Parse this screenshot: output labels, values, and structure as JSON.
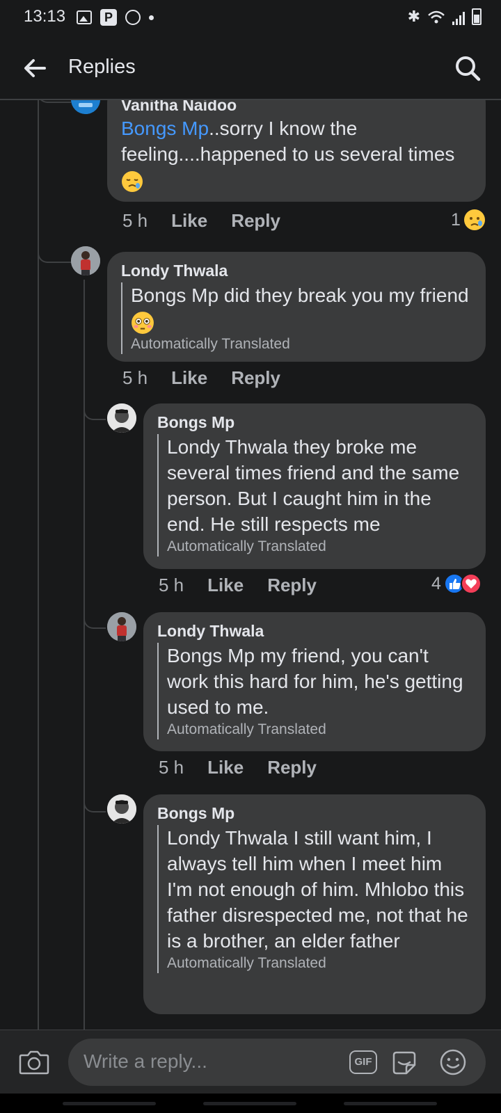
{
  "status_bar": {
    "time": "13:13",
    "notification_letter": "P"
  },
  "header": {
    "title": "Replies"
  },
  "comments": [
    {
      "author": "Vanitha Naidoo",
      "mention": "Bongs Mp",
      "text": "..sorry I know the feeling....happened to us several times",
      "time": "5 h",
      "like": "Like",
      "reply": "Reply",
      "reaction_count": "1",
      "reaction": "sad"
    },
    {
      "author": "Londy Thwala",
      "text": "Bongs Mp did they break you my friend",
      "emoji": "flushed",
      "translated": "Automatically Translated",
      "time": "5 h",
      "like": "Like",
      "reply": "Reply"
    },
    {
      "author": "Bongs Mp",
      "text": "Londy Thwala they broke me several times friend and the same person. But I caught him in the end. He still respects me",
      "translated": "Automatically Translated",
      "time": "5 h",
      "like": "Like",
      "reply": "Reply",
      "reaction_count": "4",
      "reactions": [
        "like",
        "love"
      ]
    },
    {
      "author": "Londy Thwala",
      "text": "Bongs Mp my friend, you can't work this hard for him, he's getting used to me.",
      "translated": "Automatically Translated",
      "time": "5 h",
      "like": "Like",
      "reply": "Reply"
    },
    {
      "author": "Bongs Mp",
      "text": "Londy Thwala I still want him, I always tell him when I meet him I'm not enough of him. Mhlobo this father disrespected me, not that he is a brother, an elder father",
      "translated": "Automatically Translated"
    }
  ],
  "composer": {
    "placeholder": "Write a reply...",
    "gif_label": "GIF"
  },
  "colors": {
    "background": "#18191a",
    "bubble": "#3a3b3c",
    "mention": "#4599ff",
    "secondary_text": "#b0b3b8",
    "like_blue": "#1877f2",
    "love_red": "#f33e58"
  }
}
